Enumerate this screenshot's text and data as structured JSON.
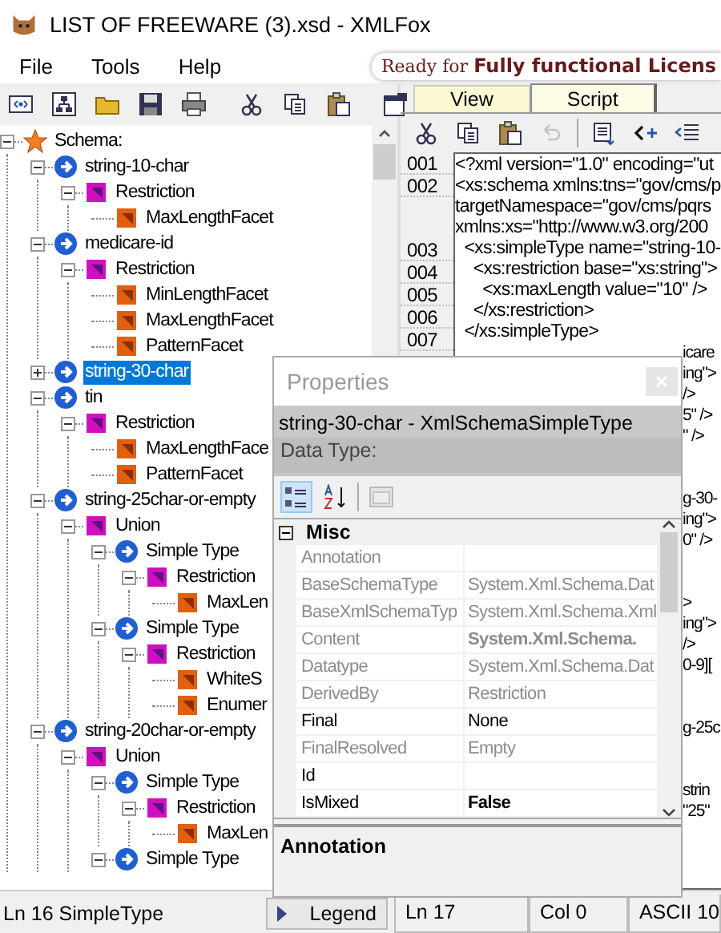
{
  "window": {
    "title": "LIST OF FREEWARE (3).xsd - XMLFox"
  },
  "menu": [
    {
      "label": "File"
    },
    {
      "label": "Tools"
    },
    {
      "label": "Help"
    }
  ],
  "banner": {
    "text": "Ready for **Fully functional Licens**"
  },
  "tree": [
    {
      "label": "Schema:",
      "kind": "schema",
      "expanded": true,
      "selected": false,
      "children": [
        {
          "label": "string-10-char",
          "kind": "simple_type",
          "expanded": true,
          "selected": false,
          "children": [
            {
              "label": "Restriction",
              "kind": "derivation",
              "expanded": true,
              "selected": false,
              "children": [
                {
                  "label": "MaxLengthFacet",
                  "kind": "facet",
                  "selected": false
                }
              ]
            }
          ]
        },
        {
          "label": "medicare-id",
          "kind": "simple_type",
          "expanded": true,
          "selected": false,
          "children": [
            {
              "label": "Restriction",
              "kind": "derivation",
              "expanded": true,
              "selected": false,
              "children": [
                {
                  "label": "MinLengthFacet",
                  "kind": "facet",
                  "selected": false
                },
                {
                  "label": "MaxLengthFacet",
                  "kind": "facet",
                  "selected": false
                },
                {
                  "label": "PatternFacet",
                  "kind": "facet",
                  "selected": false
                }
              ]
            }
          ]
        },
        {
          "label": "string-30-char",
          "kind": "simple_type",
          "expanded": false,
          "selected": true
        },
        {
          "label": "tin",
          "kind": "simple_type",
          "expanded": true,
          "selected": false,
          "children": [
            {
              "label": "Restriction",
              "kind": "derivation",
              "expanded": true,
              "selected": false,
              "children": [
                {
                  "label": "MaxLengthFace",
                  "kind": "facet",
                  "selected": false
                },
                {
                  "label": "PatternFacet",
                  "kind": "facet",
                  "selected": false
                }
              ]
            }
          ]
        },
        {
          "label": "string-25char-or-empty",
          "kind": "simple_type",
          "expanded": true,
          "selected": false,
          "children": [
            {
              "label": "Union",
              "kind": "derivation",
              "expanded": true,
              "selected": false,
              "children": [
                {
                  "label": "Simple Type",
                  "kind": "simple_type",
                  "expanded": true,
                  "selected": false,
                  "children": [
                    {
                      "label": "Restriction",
                      "kind": "derivation",
                      "expanded": true,
                      "selected": false,
                      "children": [
                        {
                          "label": "MaxLen",
                          "kind": "facet",
                          "selected": false
                        }
                      ]
                    }
                  ]
                },
                {
                  "label": "Simple Type",
                  "kind": "simple_type",
                  "expanded": true,
                  "selected": false,
                  "children": [
                    {
                      "label": "Restriction",
                      "kind": "derivation",
                      "expanded": true,
                      "selected": false,
                      "children": [
                        {
                          "label": "WhiteS",
                          "kind": "facet",
                          "selected": false
                        },
                        {
                          "label": "Enumer",
                          "kind": "facet",
                          "selected": false
                        }
                      ]
                    }
                  ]
                }
              ]
            }
          ]
        },
        {
          "label": "string-20char-or-empty",
          "kind": "simple_type",
          "expanded": true,
          "selected": false,
          "children": [
            {
              "label": "Union",
              "kind": "derivation",
              "expanded": true,
              "selected": false,
              "children": [
                {
                  "label": "Simple Type",
                  "kind": "simple_type",
                  "expanded": true,
                  "selected": false,
                  "children": [
                    {
                      "label": "Restriction",
                      "kind": "derivation",
                      "expanded": true,
                      "selected": false,
                      "children": [
                        {
                          "label": "MaxLen",
                          "kind": "facet",
                          "selected": false
                        }
                      ]
                    }
                  ]
                },
                {
                  "label": "Simple Type",
                  "kind": "simple_type",
                  "expanded": true,
                  "selected": false
                }
              ]
            }
          ]
        }
      ]
    }
  ],
  "editor": {
    "tabs": [
      {
        "label": "View",
        "selected": false
      },
      {
        "label": "Script",
        "selected": true
      }
    ],
    "toolbar": [
      {
        "kind": "cut",
        "disabled": false
      },
      {
        "kind": "copy",
        "disabled": false
      },
      {
        "kind": "paste",
        "disabled": false
      },
      {
        "kind": "undo",
        "disabled": true
      },
      {
        "kind": "format",
        "disabled": false
      },
      {
        "kind": "tag",
        "disabled": false
      },
      {
        "kind": "indent",
        "disabled": false
      }
    ],
    "lines": [
      {
        "number": "001",
        "rows": [
          "<?xml version=\"1.0\" encoding=\"ut"
        ]
      },
      {
        "number": "002",
        "rows": [
          "<xs:schema xmlns:tns=\"gov/cms/p",
          "targetNamespace=\"gov/cms/pqrs",
          "xmlns:xs=\"http://www.w3.org/200"
        ]
      },
      {
        "number": "003",
        "rows": [
          "  <xs:simpleType name=\"string-10-"
        ]
      },
      {
        "number": "004",
        "rows": [
          "    <xs:restriction base=\"xs:string\">"
        ]
      },
      {
        "number": "005",
        "rows": [
          "      <xs:maxLength value=\"10\" />"
        ]
      },
      {
        "number": "006",
        "rows": [
          "    </xs:restriction>"
        ]
      },
      {
        "number": "007",
        "rows": [
          "  </xs:simpleType>"
        ]
      }
    ],
    "covered_lines": [
      [
        "icare",
        "ing\">",
        "/>",
        "5\" />",
        "\" />"
      ],
      [
        "g-30-",
        "ing\">",
        "0\" />"
      ],
      [
        ">",
        "ing\">",
        "/>",
        "0-9]["
      ],
      [
        "g-25c"
      ],
      [
        "strin",
        "\"25\""
      ]
    ]
  },
  "properties": {
    "title": "Properties",
    "object": "string-30-char - XmlSchemaSimpleType",
    "data_type": "Data Type:",
    "toolbar": [
      {
        "kind": "categorized",
        "selected": true,
        "disabled": false
      },
      {
        "kind": "alphabetical",
        "selected": false,
        "disabled": false
      },
      {
        "kind": "pages",
        "selected": false,
        "disabled": true
      }
    ],
    "category": {
      "label": "Misc",
      "expanded": true
    },
    "rows": [
      {
        "name": "Annotation",
        "readonly": true,
        "selected": false
      },
      {
        "name": "BaseSchemaType",
        "value": "System.Xml.Schema.Dat",
        "readonly": true,
        "bold": false,
        "selected": false
      },
      {
        "name": "BaseXmlSchemaTyp",
        "value": "System.Xml.Schema.Xml",
        "readonly": true,
        "bold": false,
        "selected": false
      },
      {
        "name": "Content",
        "value": "System.Xml.Schema.",
        "readonly": true,
        "bold": true,
        "selected": false
      },
      {
        "name": "Datatype",
        "value": "System.Xml.Schema.Dat",
        "readonly": true,
        "bold": false,
        "selected": false
      },
      {
        "name": "DerivedBy",
        "value": "Restriction",
        "readonly": true,
        "bold": false,
        "selected": false
      },
      {
        "name": "Final",
        "value": "None",
        "readonly": false,
        "bold": false,
        "selected": false
      },
      {
        "name": "FinalResolved",
        "value": "Empty",
        "readonly": true,
        "bold": false,
        "selected": false
      },
      {
        "name": "Id",
        "readonly": false,
        "selected": false
      },
      {
        "name": "IsMixed",
        "value": "False",
        "readonly": false,
        "bold": true,
        "selected": false
      }
    ],
    "description": "Annotation"
  },
  "status_bar": {
    "left": "Ln 16  SimpleType",
    "legend": "Legend",
    "line": "Ln 17",
    "column": "Col 0",
    "char": "ASCII 10"
  }
}
